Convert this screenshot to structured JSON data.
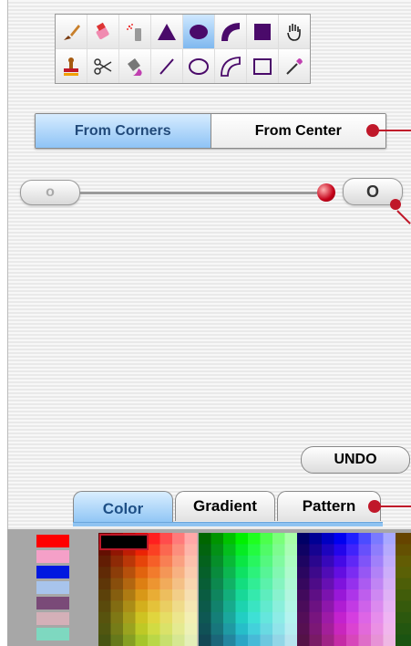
{
  "tools": [
    {
      "name": "brush-icon"
    },
    {
      "name": "eraser-icon"
    },
    {
      "name": "spray-icon"
    },
    {
      "name": "triangle-icon"
    },
    {
      "name": "oval-filled-icon",
      "selected": true
    },
    {
      "name": "arc-filled-icon"
    },
    {
      "name": "rect-filled-icon"
    },
    {
      "name": "hand-icon"
    },
    {
      "name": "stamp-icon"
    },
    {
      "name": "scissors-icon"
    },
    {
      "name": "bucket-icon"
    },
    {
      "name": "line-icon"
    },
    {
      "name": "oval-outline-icon"
    },
    {
      "name": "arc-outline-icon"
    },
    {
      "name": "rect-outline-icon"
    },
    {
      "name": "eyedropper-icon"
    }
  ],
  "draw_mode": {
    "from_corners": "From Corners",
    "from_center": "From Center",
    "selected": "From Corners"
  },
  "size_slider": {
    "min_label": "o",
    "max_label": "O",
    "value": 1.0
  },
  "undo_label": "UNDO",
  "tabs": {
    "color": "Color",
    "gradient": "Gradient",
    "pattern": "Pattern",
    "active": "Color"
  },
  "colors": {
    "accent": "#c0182a",
    "selection": "#8ec3f5",
    "swatches": [
      "#ff0000",
      "#f5a0c8",
      "#0018e0",
      "#a8c4ec",
      "#7a4a78",
      "#d4b0b8",
      "#7ed8c0"
    ]
  }
}
